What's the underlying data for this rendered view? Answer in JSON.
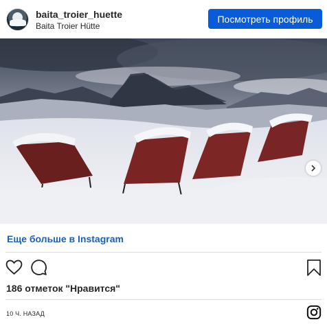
{
  "header": {
    "username": "baita_troier_huette",
    "location": "Baita Troier Hütte",
    "view_profile_label": "Посмотреть профиль"
  },
  "post": {
    "image_alt": "",
    "more_link_label": "Еще больше в Instagram",
    "likes_text": "186 отметок \"Нравится\"",
    "time_text": "10 Ч. НАЗАД"
  },
  "icons": {
    "like": "heart-icon",
    "comment": "comment-icon",
    "save": "bookmark-icon",
    "next": "chevron-right-icon",
    "brand": "instagram-logo-icon"
  },
  "colors": {
    "accent": "#0a5bd7",
    "link": "#1a5fb4",
    "text": "#262626",
    "divider": "#dbdbdb"
  }
}
